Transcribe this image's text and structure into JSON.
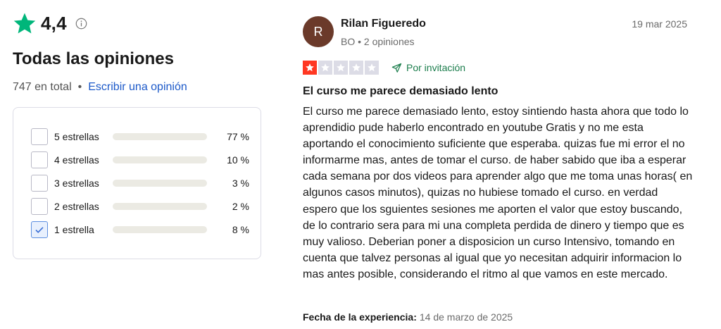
{
  "summary": {
    "score": "4,4",
    "title": "Todas las opiniones",
    "total": "747 en total",
    "separator": "•",
    "write_link": "Escribir una opinión",
    "icons": {
      "score": "star-icon",
      "info": "info-icon"
    },
    "colors": {
      "brand_green": "#00b67a",
      "link_blue": "#1c59c9"
    }
  },
  "rating_filter": [
    {
      "label": "5 estrellas",
      "percent_text": "77 %",
      "share": 0.77,
      "checked": false,
      "bar_color": "#a3a3a3"
    },
    {
      "label": "4 estrellas",
      "percent_text": "10 %",
      "share": 0.1,
      "checked": false,
      "bar_color": "#a3a3a3"
    },
    {
      "label": "3 estrellas",
      "percent_text": "3 %",
      "share": 0.03,
      "checked": false,
      "bar_color": "#a3a3a3"
    },
    {
      "label": "2 estrellas",
      "percent_text": "2 %",
      "share": 0.02,
      "checked": false,
      "bar_color": "#a3a3a3"
    },
    {
      "label": "1 estrella",
      "percent_text": "8 %",
      "share": 0.08,
      "checked": true,
      "bar_color": "#ff3722"
    }
  ],
  "review": {
    "avatar_initial": "R",
    "reviewer_name": "Rilan Figueredo",
    "reviewer_meta": "BO • 2 opiniones",
    "date": "19 mar 2025",
    "stars": 1,
    "stars_max": 5,
    "star_color": "#ff3722",
    "invited_label": "Por invitación",
    "title": "El curso me parece demasiado lento",
    "body": "El curso me parece demasiado lento, estoy sintiendo hasta ahora que todo lo aprendidio pude haberlo encontrado en youtube Gratis y no me esta aportando el conocimiento suficiente que esperaba. quizas fue mi error el no informarme mas, antes de tomar el curso. de haber sabido que iba a esperar cada semana por dos videos para aprender algo que me toma unas horas( en algunos casos minutos), quizas no hubiese tomado el curso. en verdad espero que los sguientes sesiones me aporten el valor que estoy buscando, de lo contrario sera para mi una completa perdida de dinero y tiempo que es muy valioso. Deberian poner a disposicion un curso Intensivo, tomando en cuenta que talvez personas al igual que yo necesitan adquirir informacion lo mas antes posible, considerando el ritmo al que vamos en este mercado.",
    "experience_label": "Fecha de la experiencia:",
    "experience_date": "14 de marzo de 2025"
  }
}
